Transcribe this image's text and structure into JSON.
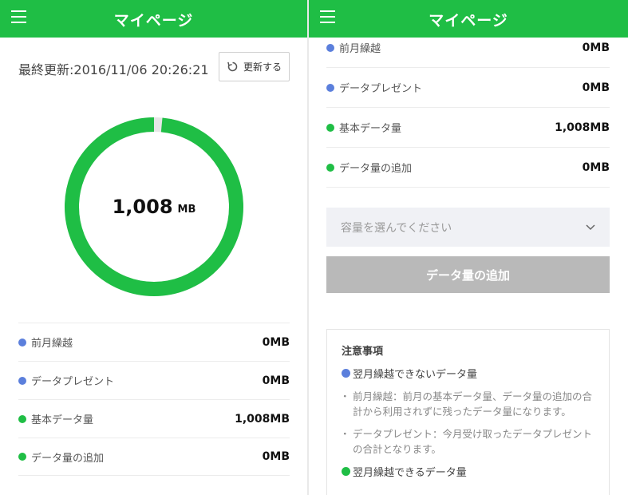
{
  "header": {
    "title": "マイページ"
  },
  "left": {
    "updated": "最終更新:2016/11/06 20:26:21",
    "refresh_label": "更新する",
    "usage": {
      "remaining": "1,008",
      "unit": "MB",
      "remaining_fraction": 0.985
    },
    "rows": [
      {
        "label": "前月繰越",
        "value": "0MB",
        "color": "#5b7fdc"
      },
      {
        "label": "データプレゼント",
        "value": "0MB",
        "color": "#5b7fdc"
      },
      {
        "label": "基本データ量",
        "value": "1,008MB",
        "color": "#1fbe45"
      },
      {
        "label": "データ量の追加",
        "value": "0MB",
        "color": "#1fbe45"
      }
    ]
  },
  "right": {
    "rows": [
      {
        "label": "前月繰越",
        "value": "0MB",
        "color": "#5b7fdc"
      },
      {
        "label": "データプレゼント",
        "value": "0MB",
        "color": "#5b7fdc"
      },
      {
        "label": "基本データ量",
        "value": "1,008MB",
        "color": "#1fbe45"
      },
      {
        "label": "データ量の追加",
        "value": "0MB",
        "color": "#1fbe45"
      }
    ],
    "select_placeholder": "容量を選んでください",
    "add_button": "データ量の追加",
    "notice": {
      "title": "注意事項",
      "section1": "翌月繰越できないデータ量",
      "item1": "前月繰越：前月の基本データ量、データ量の追加の合計から利用されずに残ったデータ量になります。",
      "item2": "データプレゼント：今月受け取ったデータプレゼントの合計となります。",
      "section2": "翌月繰越できるデータ量"
    }
  },
  "colors": {
    "brand": "#1fbe45",
    "blue": "#5b7fdc",
    "ring_track": "#e6e6e6"
  }
}
